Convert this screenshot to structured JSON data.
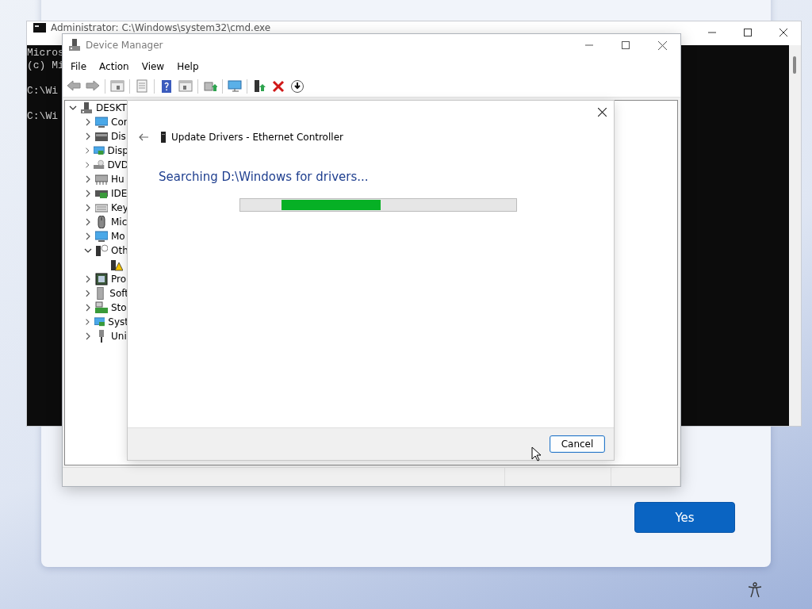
{
  "setup_card": {
    "button": "Yes"
  },
  "console_window": {
    "title": "Administrator: C:\\Windows\\system32\\cmd.exe",
    "lines": [
      "Micros",
      "(c) Mi",
      "C:\\Wi",
      "C:\\Wi"
    ]
  },
  "device_manager": {
    "title": "Device Manager",
    "menu": [
      "File",
      "Action",
      "View",
      "Help"
    ],
    "tree": [
      {
        "label": "DESKT",
        "kind": "computer",
        "expanded": true,
        "children": [
          {
            "label": "Cor",
            "kind": "monitor",
            "expanded": false
          },
          {
            "label": "Dis",
            "kind": "disk",
            "expanded": false
          },
          {
            "label": "Disp",
            "kind": "display",
            "expanded": false
          },
          {
            "label": "DVD",
            "kind": "dvd",
            "expanded": false
          },
          {
            "label": "Hu",
            "kind": "hid",
            "expanded": false
          },
          {
            "label": "IDE",
            "kind": "card",
            "expanded": false
          },
          {
            "label": "Key",
            "kind": "keyboard",
            "expanded": false
          },
          {
            "label": "Mic",
            "kind": "mouse",
            "expanded": false
          },
          {
            "label": "Mo",
            "kind": "monitor",
            "expanded": false
          },
          {
            "label": "Oth",
            "kind": "unknown",
            "expanded": true,
            "children": [
              {
                "kind": "warning"
              }
            ]
          },
          {
            "label": "Pro",
            "kind": "chip",
            "expanded": false
          },
          {
            "label": "Soft",
            "kind": "tower",
            "expanded": false
          },
          {
            "label": "Sto",
            "kind": "storage",
            "expanded": false
          },
          {
            "label": "Syst",
            "kind": "display",
            "expanded": false
          },
          {
            "label": "Uni",
            "kind": "usb",
            "expanded": false
          }
        ]
      }
    ]
  },
  "update_dialog": {
    "title": "Update Drivers - Ethernet Controller",
    "status": "Searching D:\\Windows for drivers...",
    "level": 0.36,
    "buttons": [
      "Cancel"
    ]
  }
}
